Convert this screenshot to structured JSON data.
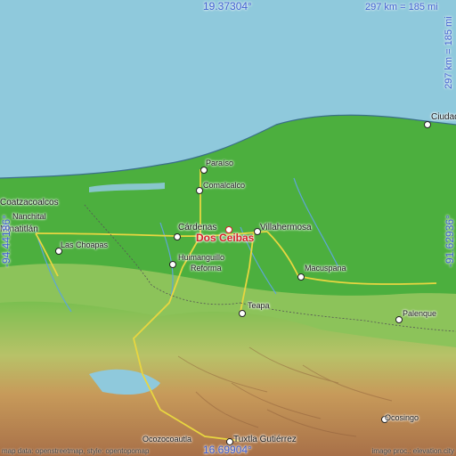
{
  "map": {
    "focus_city": "Dos Ceibas",
    "coords": {
      "top_lat": "19.37304°",
      "bottom_lat": "16.69904°",
      "left_lon": "-94.44186°",
      "right_lon": "-91.62936°",
      "scale_h": "297 km = 185 mi",
      "scale_v": "297 km = 185 mi"
    },
    "places": {
      "paraiso": "Paraíso",
      "comalcalco": "Comalcalco",
      "cardenas": "Cárdenas",
      "villahermosa": "Villahermosa",
      "coatzacoalcos": "Coatzacoalcos",
      "nanchital": "Nanchital",
      "minatitlan": "Minatitlán",
      "las_choapas": "Las Choapas",
      "huimanguillo": "Huimanguillo",
      "reforma": "Reforma",
      "macuspana": "Macuspana",
      "teapa": "Teapa",
      "palenque": "Palenque",
      "ciudad": "Ciudad",
      "ocosingo": "Ocosingo",
      "ocozocoautla": "Ocozocoautla",
      "tuxtla": "Tuxtla Gutiérrez"
    },
    "credits_left": "map data: openstreetmap, style: opentopomap",
    "credits_right": "image proc.: elevation.city",
    "colors": {
      "sea": "#8fc9dc",
      "lowland": "#4caf3e",
      "accent": "#d8202a",
      "coord": "#3f5fd0"
    }
  }
}
